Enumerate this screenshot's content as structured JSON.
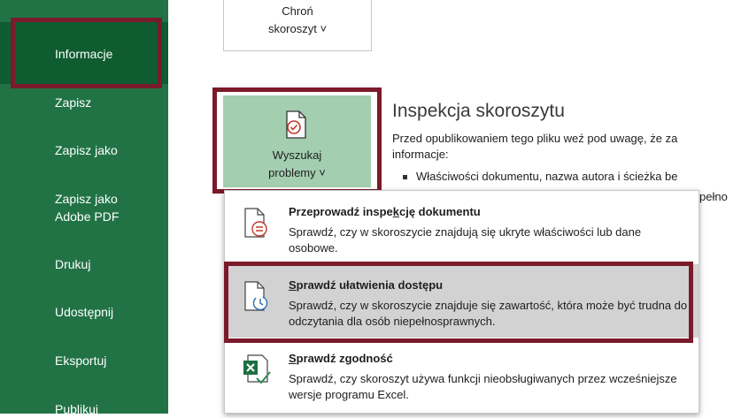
{
  "sidebar": {
    "items": [
      {
        "label": "Informacje"
      },
      {
        "label": "Zapisz"
      },
      {
        "label": "Zapisz jako"
      },
      {
        "label": "Zapisz jako"
      },
      {
        "label": "Adobe PDF"
      },
      {
        "label": "Drukuj"
      },
      {
        "label": "Udostępnij"
      },
      {
        "label": "Eksportuj"
      },
      {
        "label": "Publikuj"
      }
    ]
  },
  "protect": {
    "line1": "Chroń",
    "line2": "skoroszyt ˅"
  },
  "check_issues": {
    "line1": "Wyszukaj",
    "line2": "problemy ˅"
  },
  "inspect": {
    "title": "Inspekcja skoroszytu",
    "desc_line1": "Przed opublikowaniem tego pliku weź pod uwagę, że za",
    "desc_line2": "informacje:",
    "bullet": "Właściwości dokumentu, nazwa autora i ścieżka be",
    "tail": "pełno"
  },
  "menu": {
    "items": [
      {
        "title_pre": "Przeprowadź inspe",
        "title_u": "k",
        "title_post": "cję dokumentu",
        "desc": "Sprawdź, czy w skoroszycie znajdują się ukryte właściwości lub dane osobowe."
      },
      {
        "title_u": "S",
        "title_post": "prawdź ułatwienia dostępu",
        "desc": "Sprawdź, czy w skoroszycie znajduje się zawartość, która może być trudna do odczytania dla osób niepełnosprawnych."
      },
      {
        "title_u": "S",
        "title_post": "prawdź zgodność",
        "desc": "Sprawdź, czy skoroszyt używa funkcji nieobsługiwanych przez wcześniejsze wersje programu Excel."
      }
    ]
  },
  "colors": {
    "sidebar": "#217346",
    "sidebar_active": "#0e5c2f",
    "highlight_box": "#7a1a2a",
    "check_button": "#a3ceb0",
    "menu_hover": "#d2d2d2"
  }
}
